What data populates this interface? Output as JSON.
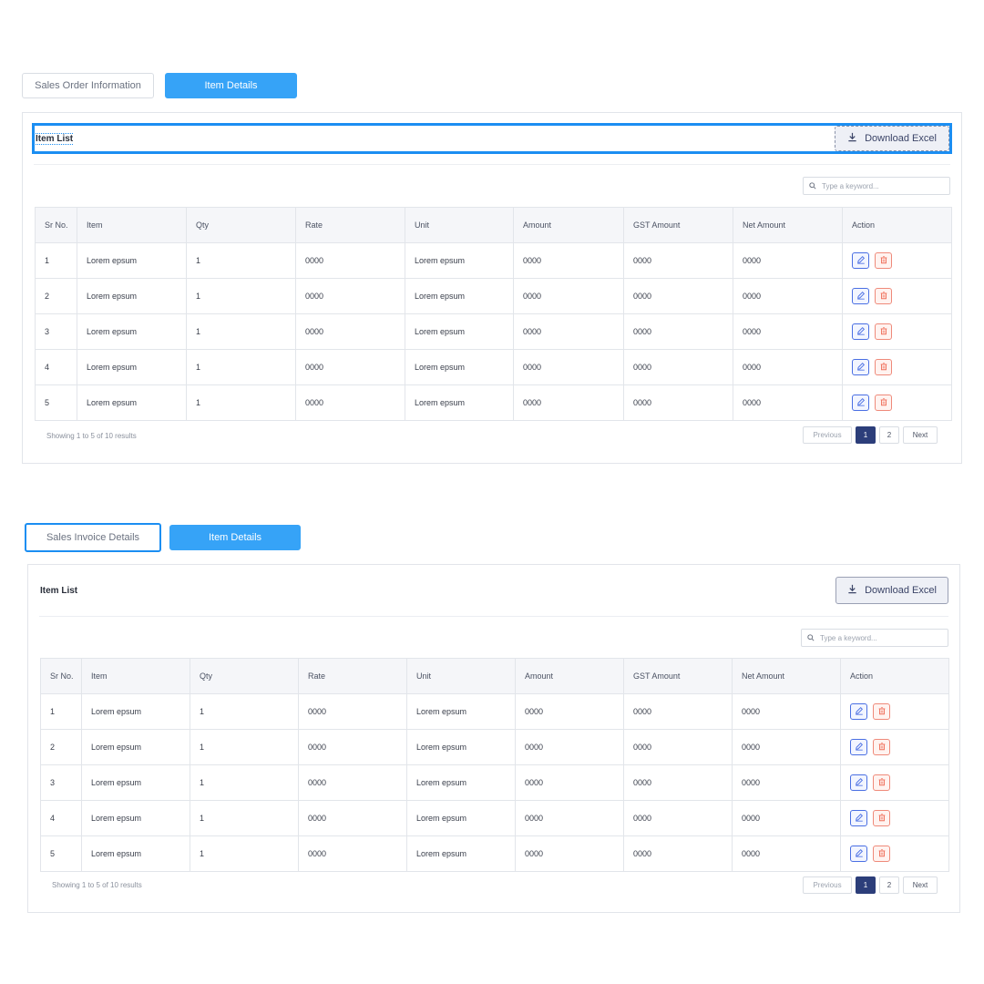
{
  "section1": {
    "tab_inactive": "Sales Order Information",
    "tab_active": "Item Details",
    "title": "Item List",
    "download_label": "Download Excel",
    "search_placeholder": "Type a keyword...",
    "columns": [
      "Sr No.",
      "Item",
      "Qty",
      "Rate",
      "Unit",
      "Amount",
      "GST Amount",
      "Net Amount",
      "Action"
    ],
    "rows": [
      [
        "1",
        "Lorem epsum",
        "1",
        "0000",
        "Lorem epsum",
        "0000",
        "0000",
        "0000"
      ],
      [
        "2",
        "Lorem epsum",
        "1",
        "0000",
        "Lorem epsum",
        "0000",
        "0000",
        "0000"
      ],
      [
        "3",
        "Lorem epsum",
        "1",
        "0000",
        "Lorem epsum",
        "0000",
        "0000",
        "0000"
      ],
      [
        "4",
        "Lorem epsum",
        "1",
        "0000",
        "Lorem epsum",
        "0000",
        "0000",
        "0000"
      ],
      [
        "5",
        "Lorem epsum",
        "1",
        "0000",
        "Lorem epsum",
        "0000",
        "0000",
        "0000"
      ]
    ],
    "showing": "Showing 1 to 5 of 10 results",
    "pager": {
      "prev": "Previous",
      "pages": [
        "1",
        "2"
      ],
      "next": "Next"
    }
  },
  "section2": {
    "tab_inactive": "Sales Invoice Details",
    "tab_active": "Item Details",
    "title": "Item List",
    "download_label": "Download Excel",
    "search_placeholder": "Type a keyword...",
    "columns": [
      "Sr No.",
      "Item",
      "Qty",
      "Rate",
      "Unit",
      "Amount",
      "GST Amount",
      "Net Amount",
      "Action"
    ],
    "rows": [
      [
        "1",
        "Lorem epsum",
        "1",
        "0000",
        "Lorem epsum",
        "0000",
        "0000",
        "0000"
      ],
      [
        "2",
        "Lorem epsum",
        "1",
        "0000",
        "Lorem epsum",
        "0000",
        "0000",
        "0000"
      ],
      [
        "3",
        "Lorem epsum",
        "1",
        "0000",
        "Lorem epsum",
        "0000",
        "0000",
        "0000"
      ],
      [
        "4",
        "Lorem epsum",
        "1",
        "0000",
        "Lorem epsum",
        "0000",
        "0000",
        "0000"
      ],
      [
        "5",
        "Lorem epsum",
        "1",
        "0000",
        "Lorem epsum",
        "0000",
        "0000",
        "0000"
      ]
    ],
    "showing": "Showing 1 to 5 of 10 results",
    "pager": {
      "prev": "Previous",
      "pages": [
        "1",
        "2"
      ],
      "next": "Next"
    }
  },
  "colors": {
    "accent": "#36a3f7",
    "selection": "#1b8ef2",
    "current_page": "#2c3e7a",
    "edit": "#4a6fe3",
    "delete": "#ef8a7a"
  },
  "icons": {
    "download": "download-icon",
    "search": "search-icon",
    "edit": "edit-icon",
    "delete": "trash-icon"
  }
}
